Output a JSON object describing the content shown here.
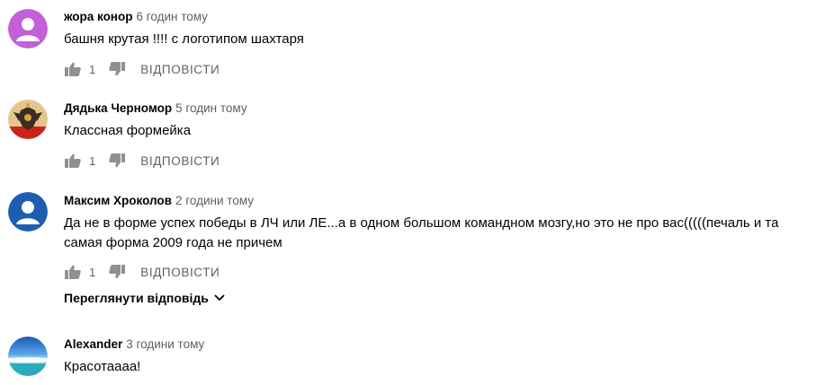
{
  "comments": [
    {
      "author": "жора конор",
      "time": "6 годин тому",
      "text": "башня крутая !!!! с логотипом шахтаря",
      "likes": "1",
      "reply_label": "ВІДПОВІСТИ",
      "avatar_color": "#c35fd9"
    },
    {
      "author": "Дядька Черномор",
      "time": "5 годин тому",
      "text": "Классная формейка",
      "likes": "1",
      "reply_label": "ВІДПОВІСТИ"
    },
    {
      "author": "Максим Хроколов",
      "time": "2 години тому",
      "text": "Да не в форме успех победы в ЛЧ или ЛЕ...а в одном большом командном мозгу,но это не про вас(((((печаль и та самая форма 2009 года не причем",
      "likes": "1",
      "reply_label": "ВІДПОВІСТИ",
      "view_replies": "Переглянути відповідь",
      "avatar_color": "#1c5fb0"
    },
    {
      "author": "Alexander",
      "time": "3 години тому",
      "text": "Красотаааа!"
    }
  ],
  "colors": {
    "primary_text": "#030303",
    "secondary_text": "#606060",
    "icon": "#909090"
  }
}
